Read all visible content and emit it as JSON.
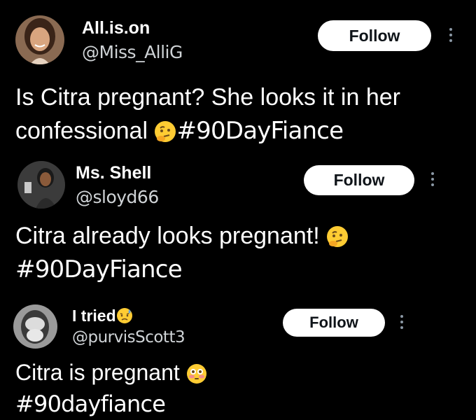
{
  "tweets": [
    {
      "name": "All.is.on",
      "handle": "@Miss_AlliG",
      "follow_label": "Follow",
      "text_line1": "Is Citra pregnant? She looks it in her",
      "text_line2": "confessional",
      "text_emoji": "thinking-face",
      "hashtag": "#90DayFiance"
    },
    {
      "name": "Ms. Shell",
      "handle": "@sloyd66",
      "follow_label": "Follow",
      "text_line1": "Citra already looks pregnant!",
      "text_emoji": "thinking-face",
      "hashtag": "#90DayFiance"
    },
    {
      "name": "I tried",
      "name_emoji": "sad-sweat-face",
      "handle": "@purvisScott3",
      "follow_label": "Follow",
      "text_line1": "Citra is pregnant",
      "text_emoji": "flushed-face",
      "hashtag": "#90dayfiance"
    }
  ],
  "colors": {
    "background": "#000000",
    "text": "#ffffff",
    "handle": "#cfd3d6",
    "follow_bg": "#ffffff",
    "follow_text": "#0f1419",
    "more_dots": "#8b98a5",
    "emoji_yellow": "#ffcc33"
  }
}
